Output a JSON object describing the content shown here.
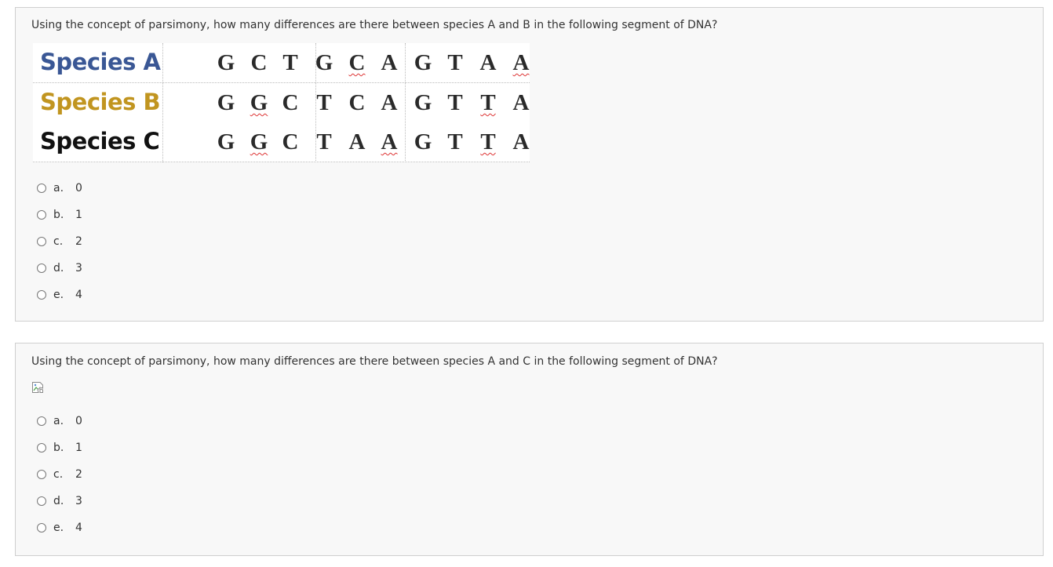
{
  "questions": [
    {
      "text": "Using the concept of parsimony, how many differences are there between species A and B in the following segment of DNA?",
      "image": {
        "rows": [
          {
            "species": "Species A",
            "color": "#3a5795",
            "bases": [
              "G",
              "C",
              "T",
              "G",
              "C",
              "A",
              "G",
              "T",
              "A",
              "A"
            ],
            "underlined": [
              4,
              9
            ]
          },
          {
            "species": "Species B",
            "color": "#c19520",
            "bases": [
              "G",
              "G",
              "C",
              "T",
              "C",
              "A",
              "G",
              "T",
              "T",
              "A"
            ],
            "underlined": [
              1,
              8
            ]
          },
          {
            "species": "Species C",
            "color": "#111111",
            "bases": [
              "G",
              "G",
              "C",
              "T",
              "A",
              "A",
              "G",
              "T",
              "T",
              "A"
            ],
            "underlined": [
              1,
              5,
              8
            ]
          }
        ]
      },
      "options": [
        {
          "letter": "a.",
          "value": "0"
        },
        {
          "letter": "b.",
          "value": "1"
        },
        {
          "letter": "c.",
          "value": "2"
        },
        {
          "letter": "d.",
          "value": "3"
        },
        {
          "letter": "e.",
          "value": "4"
        }
      ]
    },
    {
      "text": "Using the concept of parsimony, how many differences are there between species A and C in the following segment of DNA?",
      "image_icon": "broken-image-icon",
      "options": [
        {
          "letter": "a.",
          "value": "0"
        },
        {
          "letter": "b.",
          "value": "1"
        },
        {
          "letter": "c.",
          "value": "2"
        },
        {
          "letter": "d.",
          "value": "3"
        },
        {
          "letter": "e.",
          "value": "4"
        }
      ]
    }
  ]
}
